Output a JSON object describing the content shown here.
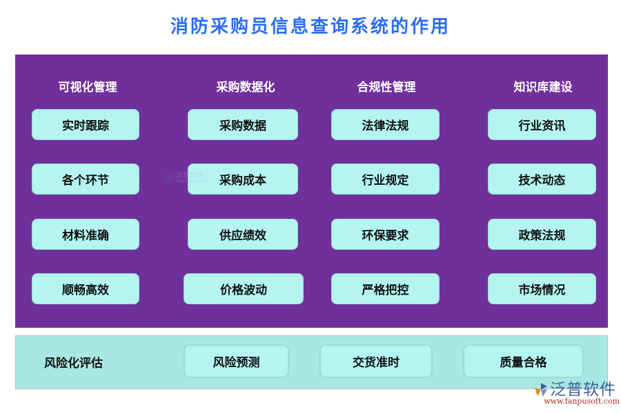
{
  "title": "消防采购员信息查询系统的作用",
  "colors": {
    "title": "#2a6df4",
    "panel_purple": "#70309b",
    "panel_teal": "#a8e8e3",
    "box_fill": "#b4f5f2",
    "brand_blue": "#3c5f9c",
    "brand_red": "#b02e27"
  },
  "columns": [
    {
      "heading": "可视化管理",
      "items": [
        "实时跟踪",
        "各个环节",
        "材料准确",
        "顺畅高效"
      ]
    },
    {
      "heading": "采购数据化",
      "items": [
        "采购数据",
        "采购成本",
        "供应绩效",
        "价格波动"
      ]
    },
    {
      "heading": "合规性管理",
      "items": [
        "法律法规",
        "行业规定",
        "环保要求",
        "严格把控"
      ]
    },
    {
      "heading": "知识库建设",
      "items": [
        "行业资讯",
        "技术动态",
        "政策法规",
        "市场情况"
      ]
    }
  ],
  "risk": {
    "label": "风险化评估",
    "items": [
      "风险预测",
      "交货准时",
      "质量合格"
    ]
  },
  "watermark": {
    "center_text": "泛普软件",
    "center_sub": "FANPU SOFTWARE",
    "brand_name": "泛普软件",
    "brand_url": "www.fanpusoft.com"
  }
}
